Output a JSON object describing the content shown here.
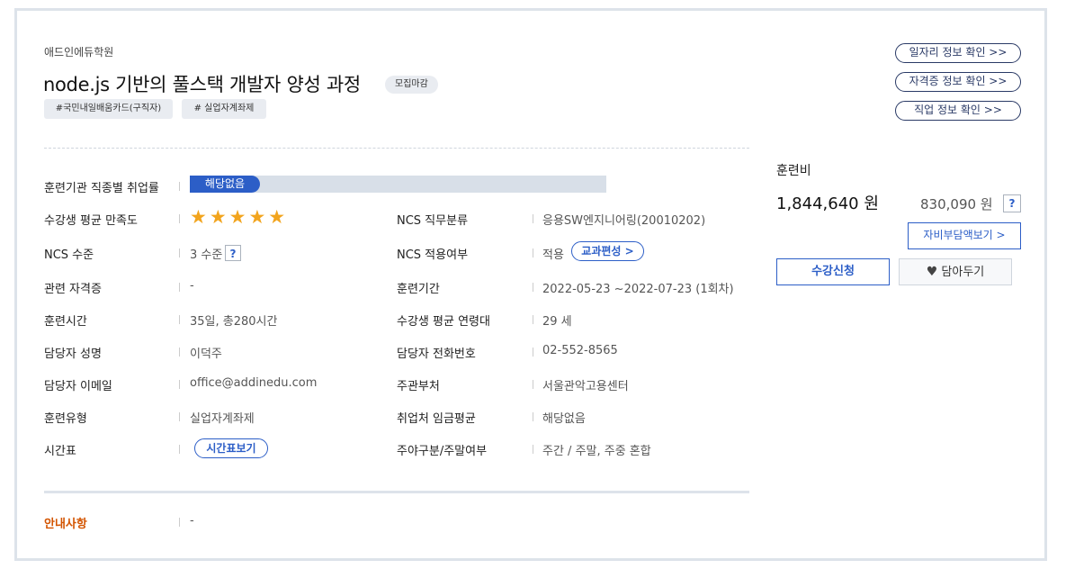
{
  "course": {
    "institution": "애드인에듀학원",
    "title": "node.js 기반의 풀스택 개발자 양성 과정",
    "status_badge": "모집마감",
    "tags": [
      "#국민내일배움카드(구직자)",
      "# 실업자계좌제"
    ]
  },
  "info": {
    "employment_rate": {
      "label": "훈련기관 직종별 취업률",
      "value": "해당없음"
    },
    "satisfaction": {
      "label": "수강생 평균 만족도",
      "stars": 5,
      "star_glyphs": "★★★★★"
    },
    "ncs_category": {
      "label": "NCS 직무분류",
      "value": "응용SW엔지니어링(20010202)"
    },
    "ncs_level": {
      "label": "NCS 수준",
      "value": "3 수준",
      "help": "?"
    },
    "ncs_apply": {
      "label": "NCS 적용여부",
      "value": "적용",
      "button": "교과편성 >"
    },
    "certificate": {
      "label": "관련 자격증",
      "value": "-"
    },
    "training_period": {
      "label": "훈련기간",
      "value": "2022-05-23 ~2022-07-23 (1회차)"
    },
    "training_time": {
      "label": "훈련시간",
      "value": "35일, 총280시간"
    },
    "avg_age": {
      "label": "수강생 평균 연령대",
      "value": "29 세"
    },
    "manager_name": {
      "label": "담당자 성명",
      "value": "이덕주"
    },
    "manager_phone": {
      "label": "담당자 전화번호",
      "value": "02-552-8565"
    },
    "manager_email": {
      "label": "담당자 이메일",
      "value": "office@addinedu.com"
    },
    "department": {
      "label": "주관부처",
      "value": "서울관악고용센터"
    },
    "training_type": {
      "label": "훈련유형",
      "value": "실업자계좌제"
    },
    "avg_wage": {
      "label": "취업처 임금평균",
      "value": "해당없음"
    },
    "timetable": {
      "label": "시간표",
      "button": "시간표보기"
    },
    "day_type": {
      "label": "주야구분/주말여부",
      "value": "주간 / 주말, 주중 혼합"
    }
  },
  "notice": {
    "label": "안내사항",
    "value": "-"
  },
  "side": {
    "links": [
      "일자리 정보 확인 >>",
      "자격증 정보 확인 >>",
      "직업 정보 확인 >>"
    ],
    "fee_label": "훈련비",
    "fee_total": "1,844,640 원",
    "fee_self": "830,090 원",
    "fee_help": "?",
    "self_pay_button": "자비부담액보기 >",
    "apply_button": "수강신청",
    "wish_button": "담아두기"
  },
  "colors": {
    "accent": "#2c5ec7",
    "star": "#f2a41d",
    "notice": "#d35400",
    "link_border": "#2a3a66"
  }
}
